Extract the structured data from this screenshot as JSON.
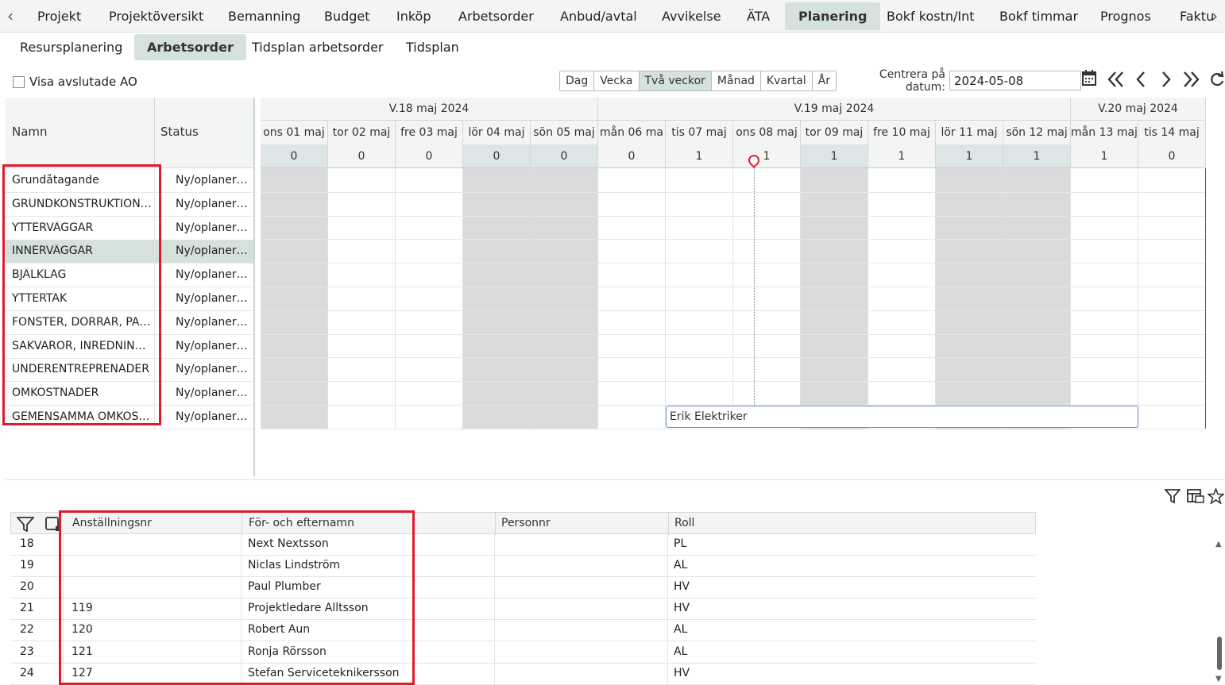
{
  "topnav": {
    "tabs": [
      "Projekt",
      "Projektöversikt",
      "Bemanning",
      "Budget",
      "Inköp",
      "Arbetsorder",
      "Anbud/avtal",
      "Avvikelse",
      "ÄTA",
      "Planering",
      "Bokf kostn/Int",
      "Bokf timmar",
      "Prognos",
      "Faktu"
    ],
    "active": "Planering"
  },
  "subnav": {
    "tabs": [
      "Resursplanering",
      "Arbetsorder",
      "Tidsplan arbetsorder",
      "Tidsplan"
    ],
    "active": "Arbetsorder"
  },
  "toolbar": {
    "show_finished_label": "Visa avslutade AO",
    "view_buttons": [
      "Dag",
      "Vecka",
      "Två veckor",
      "Månad",
      "Kvartal",
      "År"
    ],
    "active_view": "Två veckor",
    "center_label": "Centrera på datum:",
    "center_date": "2024-05-08"
  },
  "leftgrid": {
    "headers": {
      "name": "Namn",
      "status": "Status"
    },
    "rows": [
      {
        "name": "Grundåtagande",
        "status": "Ny/oplanerad"
      },
      {
        "name": "GRUNDKONSTRUKTIONER",
        "status": "Ny/oplanerad"
      },
      {
        "name": "YTTERVÄGGAR",
        "status": "Ny/oplanerad"
      },
      {
        "name": "INNERVÄGGAR",
        "status": "Ny/oplanerad"
      },
      {
        "name": "BJÄLKLAG",
        "status": "Ny/oplanerad"
      },
      {
        "name": "YTTERTAK",
        "status": "Ny/oplanerad"
      },
      {
        "name": "FÖNSTER, DÖRRAR, PARTIER",
        "status": "Ny/oplanerad"
      },
      {
        "name": "SAKVAROR, INREDNINGAR",
        "status": "Ny/oplanerad"
      },
      {
        "name": "UNDERENTREPRENADER",
        "status": "Ny/oplanerad"
      },
      {
        "name": "OMKOSTNADER",
        "status": "Ny/oplanerad"
      },
      {
        "name": "GEMENSAMMA OMKOSTNADER",
        "status": "Ny/oplanerad"
      }
    ],
    "selected_row": "INNERVÄGGAR"
  },
  "gantt": {
    "weeks": [
      {
        "label": "V.18 maj 2024"
      },
      {
        "label": "V.19 maj 2024"
      },
      {
        "label": "V.20 maj 2024"
      }
    ],
    "days": [
      {
        "label": "ons 01 maj",
        "count": "0",
        "weekend": true
      },
      {
        "label": "tor 02 maj",
        "count": "0",
        "weekend": false
      },
      {
        "label": "fre 03 maj",
        "count": "0",
        "weekend": false
      },
      {
        "label": "lör 04 maj",
        "count": "0",
        "weekend": true
      },
      {
        "label": "sön 05 maj",
        "count": "0",
        "weekend": true
      },
      {
        "label": "mån 06 ma",
        "count": "0",
        "weekend": false
      },
      {
        "label": "tis 07 maj",
        "count": "1",
        "weekend": false
      },
      {
        "label": "ons 08 maj",
        "count": "1",
        "weekend": false
      },
      {
        "label": "tor 09 maj",
        "count": "1",
        "weekend": true
      },
      {
        "label": "fre 10 maj",
        "count": "1",
        "weekend": false
      },
      {
        "label": "lör 11 maj",
        "count": "1",
        "weekend": true
      },
      {
        "label": "sön 12 maj",
        "count": "1",
        "weekend": true
      },
      {
        "label": "mån 13 maj",
        "count": "1",
        "weekend": false
      },
      {
        "label": "tis 14 maj",
        "count": "0",
        "weekend": false
      }
    ],
    "bar_label": "Erik Elektriker"
  },
  "bottomgrid": {
    "headers": {
      "empno": "Anställningsnr",
      "name": "För- och efternamn",
      "personnr": "Personnr",
      "role": "Roll"
    },
    "rows": [
      {
        "idx": "18",
        "empno": "",
        "name": "Next Nextsson",
        "personnr": "",
        "role": "PL"
      },
      {
        "idx": "19",
        "empno": "",
        "name": "Niclas Lindström",
        "personnr": "",
        "role": "AL"
      },
      {
        "idx": "20",
        "empno": "",
        "name": "Paul Plumber",
        "personnr": "",
        "role": "HV"
      },
      {
        "idx": "21",
        "empno": "119",
        "name": "Projektledare Alltsson",
        "personnr": "",
        "role": "HV"
      },
      {
        "idx": "22",
        "empno": "120",
        "name": "Robert Aun",
        "personnr": "",
        "role": "AL"
      },
      {
        "idx": "23",
        "empno": "121",
        "name": "Ronja Rörsson",
        "personnr": "",
        "role": "AL"
      },
      {
        "idx": "24",
        "empno": "127",
        "name": "Stefan Serviceteknikersson",
        "personnr": "",
        "role": "HV"
      }
    ]
  },
  "icons": {
    "nav_left": "chevron-left-icon",
    "nav_right": "chevron-right-icon",
    "calendar": "calendar-icon",
    "filter": "filter-icon",
    "export": "export-icon",
    "favorite": "star-icon",
    "refresh": "refresh-icon"
  },
  "highlight_color": "#e11c2a",
  "accent_color": "#d4e1dc"
}
